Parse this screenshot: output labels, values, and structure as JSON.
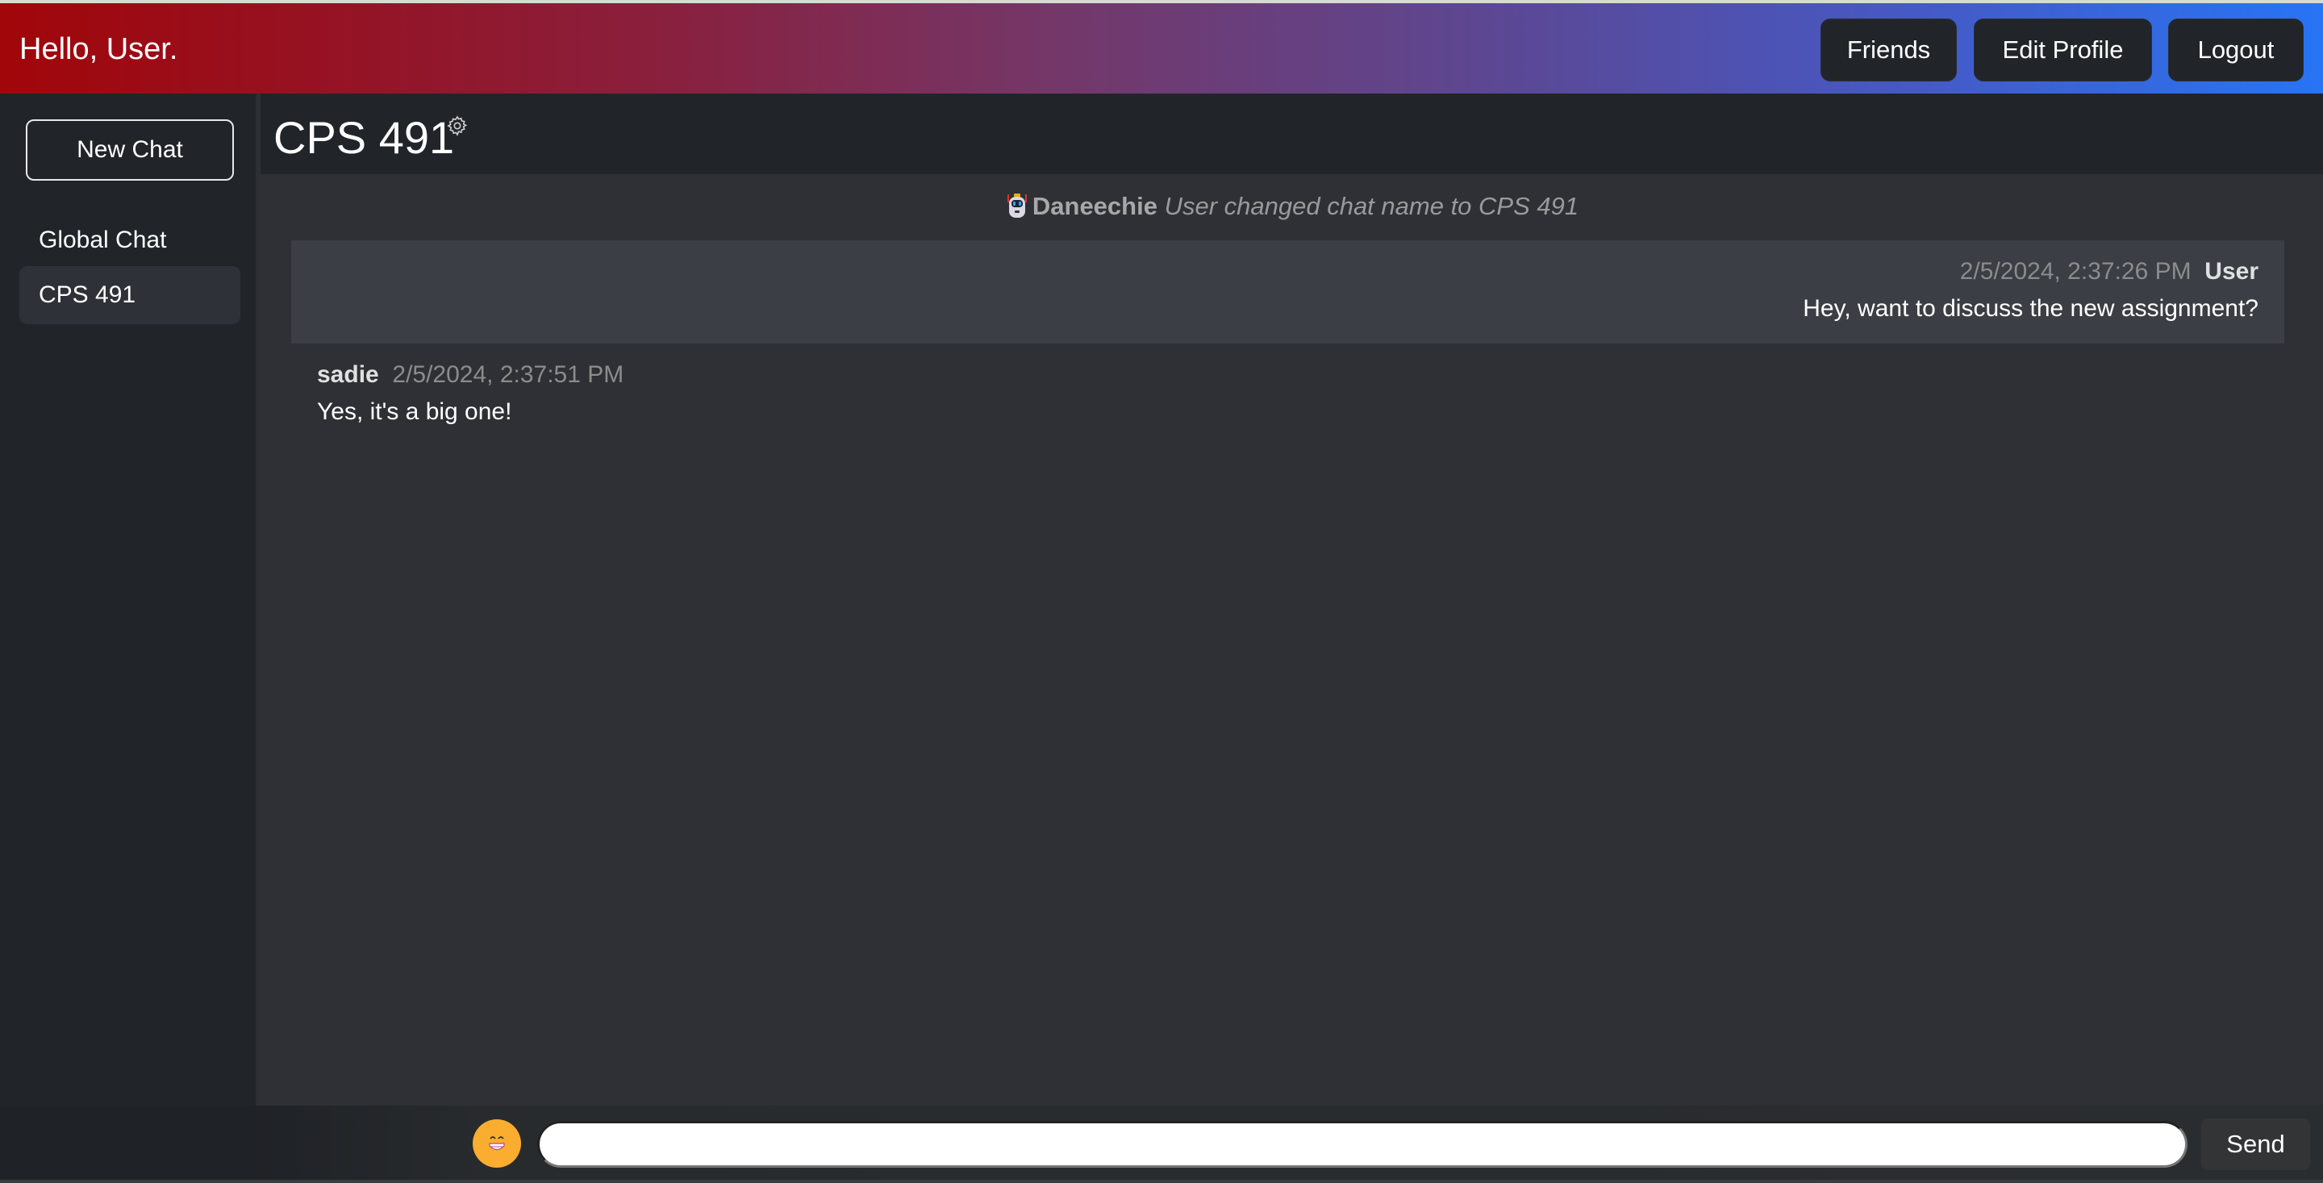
{
  "navbar": {
    "greeting": "Hello, User.",
    "buttons": {
      "friends": "Friends",
      "edit_profile": "Edit Profile",
      "logout": "Logout"
    },
    "gradient": [
      "#a1060a",
      "#743768",
      "#2774f5"
    ]
  },
  "sidebar": {
    "new_chat_label": "New Chat",
    "chats": [
      {
        "label": "Global Chat",
        "active": false
      },
      {
        "label": "CPS 491",
        "active": true
      }
    ]
  },
  "chat": {
    "title": "CPS 491",
    "settings_icon": "gear-icon",
    "system_message": {
      "icon": "robot-icon",
      "author": "Daneechie",
      "text": "User changed chat name to CPS 491"
    },
    "messages": [
      {
        "author": "User",
        "timestamp": "2/5/2024, 2:37:26 PM",
        "text": "Hey, want to discuss the new assignment?",
        "own": true
      },
      {
        "author": "sadie",
        "timestamp": "2/5/2024, 2:37:51 PM",
        "text": "Yes, it's a big one!",
        "own": false
      }
    ]
  },
  "composer": {
    "emoji_icon": "grinning-face-icon",
    "input_value": "",
    "send_label": "Send"
  }
}
